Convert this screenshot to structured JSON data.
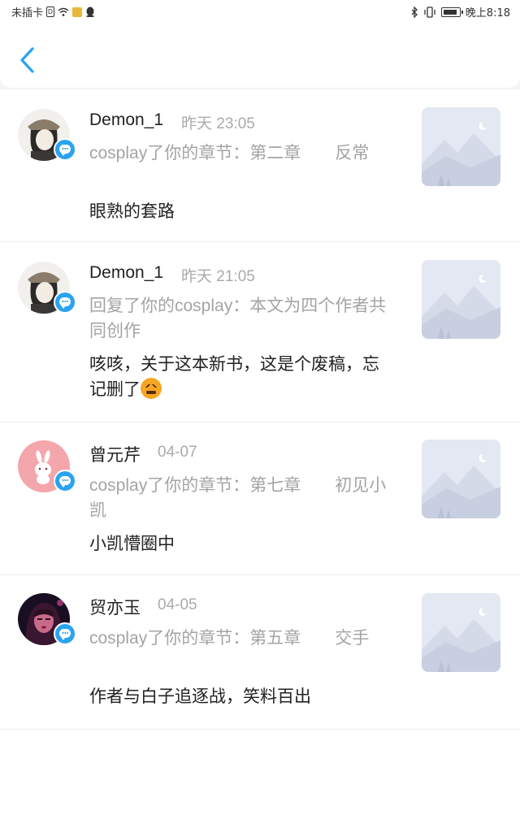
{
  "status_bar": {
    "carrier": "未插卡",
    "time": "晚上8:18"
  },
  "colors": {
    "accent": "#2aa3f0",
    "secondary_text": "#a4a4a4",
    "avatar_pink": "#f4a6ad"
  },
  "header": {
    "back_icon": "chevron-left-icon"
  },
  "messages": [
    {
      "name": "Demon_1",
      "time": "昨天 23:05",
      "subject": "cosplay了你的章节：第二章　　反常",
      "content": "眼熟的套路",
      "avatar": "girl-hat-avatar"
    },
    {
      "name": "Demon_1",
      "time": "昨天 21:05",
      "subject": "回复了你的cosplay：本文为四个作者共同创作",
      "content": "咳咳，关于这本新书，这是个废稿，忘记删了",
      "emoji": "angry-face-emoji",
      "avatar": "girl-hat-avatar"
    },
    {
      "name": "曾元芹",
      "time": "04-07",
      "subject": "cosplay了你的章节：第七章　　初见小凯",
      "content": "小凯懵圈中",
      "avatar": "pink-bunny-avatar"
    },
    {
      "name": "贸亦玉",
      "time": "04-05",
      "subject": "cosplay了你的章节：第五章　　交手",
      "content": "作者与白子追逐战，笑料百出",
      "avatar": "portrait-avatar"
    }
  ]
}
